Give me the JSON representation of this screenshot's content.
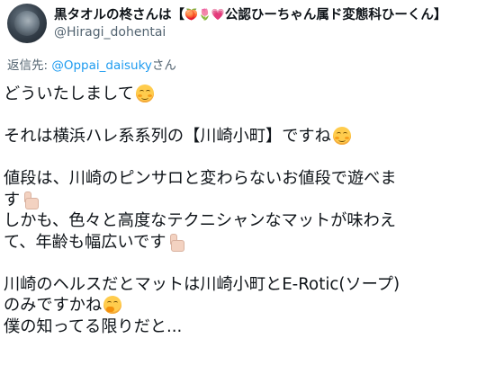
{
  "tweet": {
    "display_name": "黒タオルの柊さんは【",
    "name_badges": "🍑🌷💗",
    "name_suffix": "公認ひーちゃん属ド変態科ひーくん】",
    "handle": "@Hiragi_dohentai",
    "reply_prefix": "返信先: ",
    "reply_target": "@Oppai_daisuky",
    "reply_suffix": "さん",
    "lines": [
      "どういたしまして",
      "",
      "それは横浜ハレ系系列の【川崎小町】ですね",
      "",
      "値段は、川崎のピンサロと変わらないお値段で遊べま",
      "す",
      "しかも、色々と高度なテクニシャンなマットが味わえ",
      "て、年齢も幅広いです",
      "",
      "川崎のヘルスだとマットは川崎小町とE-Rotic(ソープ)",
      "のみですかね",
      "僕の知ってる限りだと..."
    ],
    "emojis": {
      "line0": "smiling-blush-icon",
      "line2": "smiling-face-icon",
      "line5": "thumbs-up-icon",
      "line7": "thumbs-up-icon",
      "line10": "thinking-face-icon"
    }
  }
}
